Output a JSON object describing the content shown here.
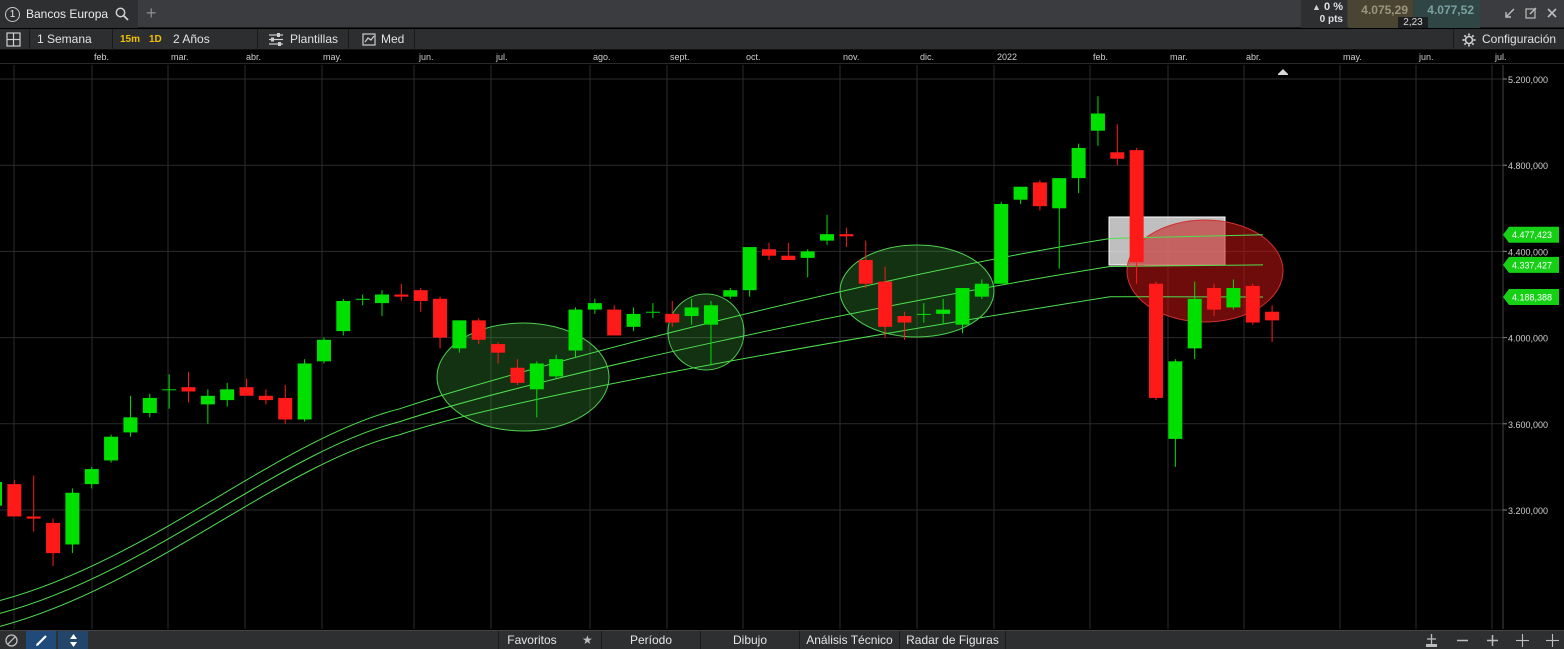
{
  "header": {
    "tab_number": "1",
    "symbol": "Bancos Europa",
    "add_tab": "+",
    "change_pct": "0 %",
    "change_pts": "0 pts",
    "sell_price": "4.075,29",
    "spread": "2,23",
    "buy_price": "4.077,52"
  },
  "toolbar": {
    "period": "1 Semana",
    "tf_15m": "15m",
    "tf_1d": "1D",
    "range": "2 Años",
    "templates": "Plantillas",
    "scale": "Med",
    "config": "Configuración"
  },
  "months": [
    "feb.",
    "mar.",
    "abr.",
    "may.",
    "jun.",
    "jul.",
    "ago.",
    "sept.",
    "oct.",
    "nov.",
    "dic.",
    "2022",
    "feb.",
    "mar.",
    "abr.",
    "may.",
    "jun.",
    "jul."
  ],
  "bottom": {
    "favorites": "Favoritos",
    "period": "Período",
    "drawing": "Dibujo",
    "technical": "Análisis Técnico",
    "radar": "Radar de Figuras"
  },
  "colors": {
    "up": "#00e000",
    "down": "#ff1a1a",
    "band": "#4fe04f",
    "label_bg": "#15d015",
    "highlight_red": "#c01010",
    "highlight_green": "#1a8a1a"
  },
  "chart_data": {
    "type": "candlestick",
    "y_axis": {
      "min": 2800000,
      "max": 5350000,
      "ticks": [
        "5.200,000",
        "4.800,000",
        "4.400,000",
        "4.000,000",
        "3.600,000",
        "3.200,000"
      ],
      "tick_values": [
        5200000,
        4800000,
        4400000,
        4000000,
        3600000,
        3200000
      ]
    },
    "price_labels": [
      "4.477,423",
      "4.337,427",
      "4.188,388"
    ],
    "price_label_values": [
      4477423,
      4337427,
      4188388
    ],
    "candles": [
      {
        "o": 3220000,
        "h": 3380000,
        "l": 3160000,
        "c": 3330000
      },
      {
        "o": 3320000,
        "h": 3340000,
        "l": 3170000,
        "c": 3170000
      },
      {
        "o": 3170000,
        "h": 3360000,
        "l": 3100000,
        "c": 3160000
      },
      {
        "o": 3140000,
        "h": 3160000,
        "l": 2940000,
        "c": 3000000
      },
      {
        "o": 3040000,
        "h": 3300000,
        "l": 3000000,
        "c": 3280000
      },
      {
        "o": 3320000,
        "h": 3400000,
        "l": 3300000,
        "c": 3390000
      },
      {
        "o": 3430000,
        "h": 3550000,
        "l": 3420000,
        "c": 3540000
      },
      {
        "o": 3560000,
        "h": 3730000,
        "l": 3540000,
        "c": 3630000
      },
      {
        "o": 3650000,
        "h": 3740000,
        "l": 3630000,
        "c": 3720000
      },
      {
        "o": 3760000,
        "h": 3830000,
        "l": 3670000,
        "c": 3760000
      },
      {
        "o": 3770000,
        "h": 3840000,
        "l": 3700000,
        "c": 3750000
      },
      {
        "o": 3690000,
        "h": 3760000,
        "l": 3600000,
        "c": 3730000
      },
      {
        "o": 3710000,
        "h": 3790000,
        "l": 3680000,
        "c": 3760000
      },
      {
        "o": 3770000,
        "h": 3810000,
        "l": 3740000,
        "c": 3730000
      },
      {
        "o": 3730000,
        "h": 3760000,
        "l": 3690000,
        "c": 3710000
      },
      {
        "o": 3720000,
        "h": 3780000,
        "l": 3600000,
        "c": 3620000
      },
      {
        "o": 3620000,
        "h": 3900000,
        "l": 3610000,
        "c": 3880000
      },
      {
        "o": 3890000,
        "h": 4000000,
        "l": 3880000,
        "c": 3990000
      },
      {
        "o": 4030000,
        "h": 4180000,
        "l": 4010000,
        "c": 4170000
      },
      {
        "o": 4180000,
        "h": 4200000,
        "l": 4150000,
        "c": 4180000
      },
      {
        "o": 4160000,
        "h": 4220000,
        "l": 4100000,
        "c": 4200000
      },
      {
        "o": 4200000,
        "h": 4250000,
        "l": 4170000,
        "c": 4190000
      },
      {
        "o": 4220000,
        "h": 4230000,
        "l": 4120000,
        "c": 4170000
      },
      {
        "o": 4180000,
        "h": 4190000,
        "l": 3950000,
        "c": 4000000
      },
      {
        "o": 3950000,
        "h": 4080000,
        "l": 3930000,
        "c": 4080000
      },
      {
        "o": 4080000,
        "h": 4090000,
        "l": 3970000,
        "c": 3990000
      },
      {
        "o": 3970000,
        "h": 3980000,
        "l": 3880000,
        "c": 3930000
      },
      {
        "o": 3860000,
        "h": 3900000,
        "l": 3780000,
        "c": 3790000
      },
      {
        "o": 3760000,
        "h": 3890000,
        "l": 3630000,
        "c": 3880000
      },
      {
        "o": 3820000,
        "h": 3920000,
        "l": 3810000,
        "c": 3900000
      },
      {
        "o": 3940000,
        "h": 4140000,
        "l": 3910000,
        "c": 4130000
      },
      {
        "o": 4130000,
        "h": 4180000,
        "l": 4110000,
        "c": 4160000
      },
      {
        "o": 4130000,
        "h": 4150000,
        "l": 4020000,
        "c": 4010000
      },
      {
        "o": 4050000,
        "h": 4140000,
        "l": 4030000,
        "c": 4110000
      },
      {
        "o": 4120000,
        "h": 4160000,
        "l": 4090000,
        "c": 4120000
      },
      {
        "o": 4110000,
        "h": 4170000,
        "l": 4050000,
        "c": 4070000
      },
      {
        "o": 4100000,
        "h": 4180000,
        "l": 4060000,
        "c": 4140000
      },
      {
        "o": 4060000,
        "h": 4170000,
        "l": 3870000,
        "c": 4150000
      },
      {
        "o": 4190000,
        "h": 4230000,
        "l": 4180000,
        "c": 4220000
      },
      {
        "o": 4220000,
        "h": 4420000,
        "l": 4190000,
        "c": 4420000
      },
      {
        "o": 4410000,
        "h": 4440000,
        "l": 4360000,
        "c": 4380000
      },
      {
        "o": 4380000,
        "h": 4440000,
        "l": 4360000,
        "c": 4360000
      },
      {
        "o": 4370000,
        "h": 4410000,
        "l": 4280000,
        "c": 4400000
      },
      {
        "o": 4450000,
        "h": 4570000,
        "l": 4430000,
        "c": 4480000
      },
      {
        "o": 4480000,
        "h": 4510000,
        "l": 4420000,
        "c": 4470000
      },
      {
        "o": 4360000,
        "h": 4450000,
        "l": 4230000,
        "c": 4250000
      },
      {
        "o": 4260000,
        "h": 4330000,
        "l": 4000000,
        "c": 4050000
      },
      {
        "o": 4100000,
        "h": 4120000,
        "l": 3990000,
        "c": 4070000
      },
      {
        "o": 4110000,
        "h": 4160000,
        "l": 4070000,
        "c": 4110000
      },
      {
        "o": 4110000,
        "h": 4180000,
        "l": 4060000,
        "c": 4130000
      },
      {
        "o": 4060000,
        "h": 4230000,
        "l": 4020000,
        "c": 4230000
      },
      {
        "o": 4190000,
        "h": 4270000,
        "l": 4180000,
        "c": 4250000
      },
      {
        "o": 4250000,
        "h": 4630000,
        "l": 4250000,
        "c": 4620000
      },
      {
        "o": 4640000,
        "h": 4680000,
        "l": 4620000,
        "c": 4700000
      },
      {
        "o": 4720000,
        "h": 4730000,
        "l": 4590000,
        "c": 4610000
      },
      {
        "o": 4600000,
        "h": 4640000,
        "l": 4320000,
        "c": 4740000
      },
      {
        "o": 4740000,
        "h": 4900000,
        "l": 4670000,
        "c": 4880000
      },
      {
        "o": 4960000,
        "h": 5120000,
        "l": 4890000,
        "c": 5040000
      },
      {
        "o": 4860000,
        "h": 4990000,
        "l": 4800000,
        "c": 4830000
      },
      {
        "o": 4870000,
        "h": 4880000,
        "l": 4250000,
        "c": 4350000
      },
      {
        "o": 4250000,
        "h": 4260000,
        "l": 3710000,
        "c": 3720000
      },
      {
        "o": 3530000,
        "h": 3900000,
        "l": 3400000,
        "c": 3890000
      },
      {
        "o": 3950000,
        "h": 4260000,
        "l": 3900000,
        "c": 4180000
      },
      {
        "o": 4230000,
        "h": 4250000,
        "l": 4100000,
        "c": 4130000
      },
      {
        "o": 4140000,
        "h": 4270000,
        "l": 4130000,
        "c": 4230000
      },
      {
        "o": 4240000,
        "h": 4250000,
        "l": 4060000,
        "c": 4070000
      },
      {
        "o": 4120000,
        "h": 4150000,
        "l": 3980000,
        "c": 4080000
      }
    ],
    "bands": {
      "upper": [
        [
          0,
          2780000
        ],
        [
          400,
          3670000
        ],
        [
          1110,
          4460000
        ],
        [
          1263,
          4477423
        ]
      ],
      "middle": [
        [
          0,
          2720000
        ],
        [
          400,
          3610000
        ],
        [
          1110,
          4330000
        ],
        [
          1263,
          4337427
        ]
      ],
      "lower": [
        [
          0,
          2660000
        ],
        [
          400,
          3550000
        ],
        [
          1110,
          4190000
        ],
        [
          1263,
          4188388
        ]
      ]
    }
  }
}
